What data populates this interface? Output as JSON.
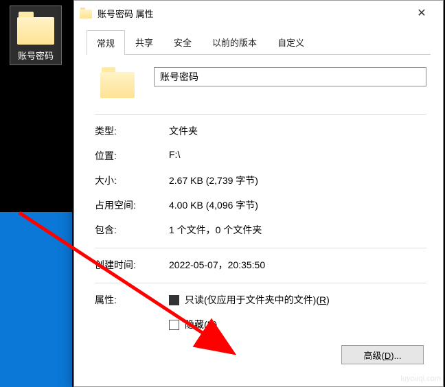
{
  "desktop": {
    "item_label": "账号密码"
  },
  "dialog": {
    "title": "账号密码 属性",
    "close_glyph": "✕",
    "tabs": [
      "常规",
      "共享",
      "安全",
      "以前的版本",
      "自定义"
    ],
    "name_value": "账号密码",
    "fields": {
      "type_k": "类型:",
      "type_v": "文件夹",
      "loc_k": "位置:",
      "loc_v": "F:\\",
      "size_k": "大小:",
      "size_v": "2.67 KB (2,739 字节)",
      "disk_k": "占用空间:",
      "disk_v": "4.00 KB (4,096 字节)",
      "contains_k": "包含:",
      "contains_v": "1 个文件，0 个文件夹",
      "created_k": "创建时间:",
      "created_v": "2022-05-07，20:35:50",
      "attr_k": "属性:",
      "readonly_label_pre": "只读(仅应用于文件夹中的文件)(",
      "readonly_hot": "R",
      "readonly_label_post": ")",
      "hidden_label_pre": "隐藏(",
      "hidden_hot": "H",
      "hidden_label_post": ")",
      "advanced_pre": "高级(",
      "advanced_hot": "D",
      "advanced_post": ")..."
    }
  },
  "watermark": "luyouqi.com"
}
